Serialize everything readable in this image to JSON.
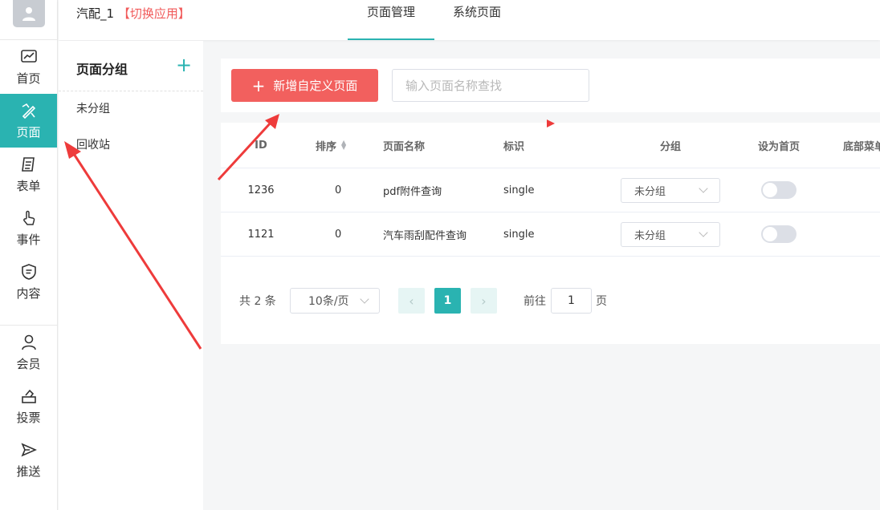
{
  "nav": {
    "items": [
      {
        "label": "首页",
        "icon": "chart-icon"
      },
      {
        "label": "页面",
        "icon": "design-tools-icon",
        "active": true
      },
      {
        "label": "表单",
        "icon": "form-icon"
      },
      {
        "label": "事件",
        "icon": "click-hand-icon"
      },
      {
        "label": "内容",
        "icon": "shield-doc-icon"
      },
      {
        "label": "会员",
        "icon": "user-icon"
      },
      {
        "label": "投票",
        "icon": "ballot-icon"
      },
      {
        "label": "推送",
        "icon": "send-icon"
      }
    ]
  },
  "header": {
    "app_name": "汽配_1",
    "switch_app": "【切换应用】",
    "tabs": [
      {
        "label": "页面管理",
        "active": true
      },
      {
        "label": "系统页面",
        "active": false
      }
    ]
  },
  "groups": {
    "title": "页面分组",
    "items": [
      "未分组",
      "回收站"
    ]
  },
  "toolbar": {
    "add_label": "新增自定义页面",
    "search_placeholder": "输入页面名称查找",
    "search_value": ""
  },
  "table": {
    "columns": [
      "ID",
      "排序",
      "页面名称",
      "标识",
      "分组",
      "设为首页",
      "底部菜单"
    ],
    "rows": [
      {
        "id": "1236",
        "sort": "0",
        "name": "pdf附件查询",
        "tag": "single",
        "group": "未分组",
        "is_home": false
      },
      {
        "id": "1121",
        "sort": "0",
        "name": "汽车雨刮配件查询",
        "tag": "single",
        "group": "未分组",
        "is_home": false
      }
    ]
  },
  "pagination": {
    "total": "共 2 条",
    "page_size": "10条/页",
    "current": "1",
    "goto_label": "前往",
    "goto_value": "1",
    "goto_unit": "页"
  },
  "colors": {
    "accent": "#2ab3b1",
    "danger": "#f2605e",
    "annotation": "#ee3b3b"
  }
}
